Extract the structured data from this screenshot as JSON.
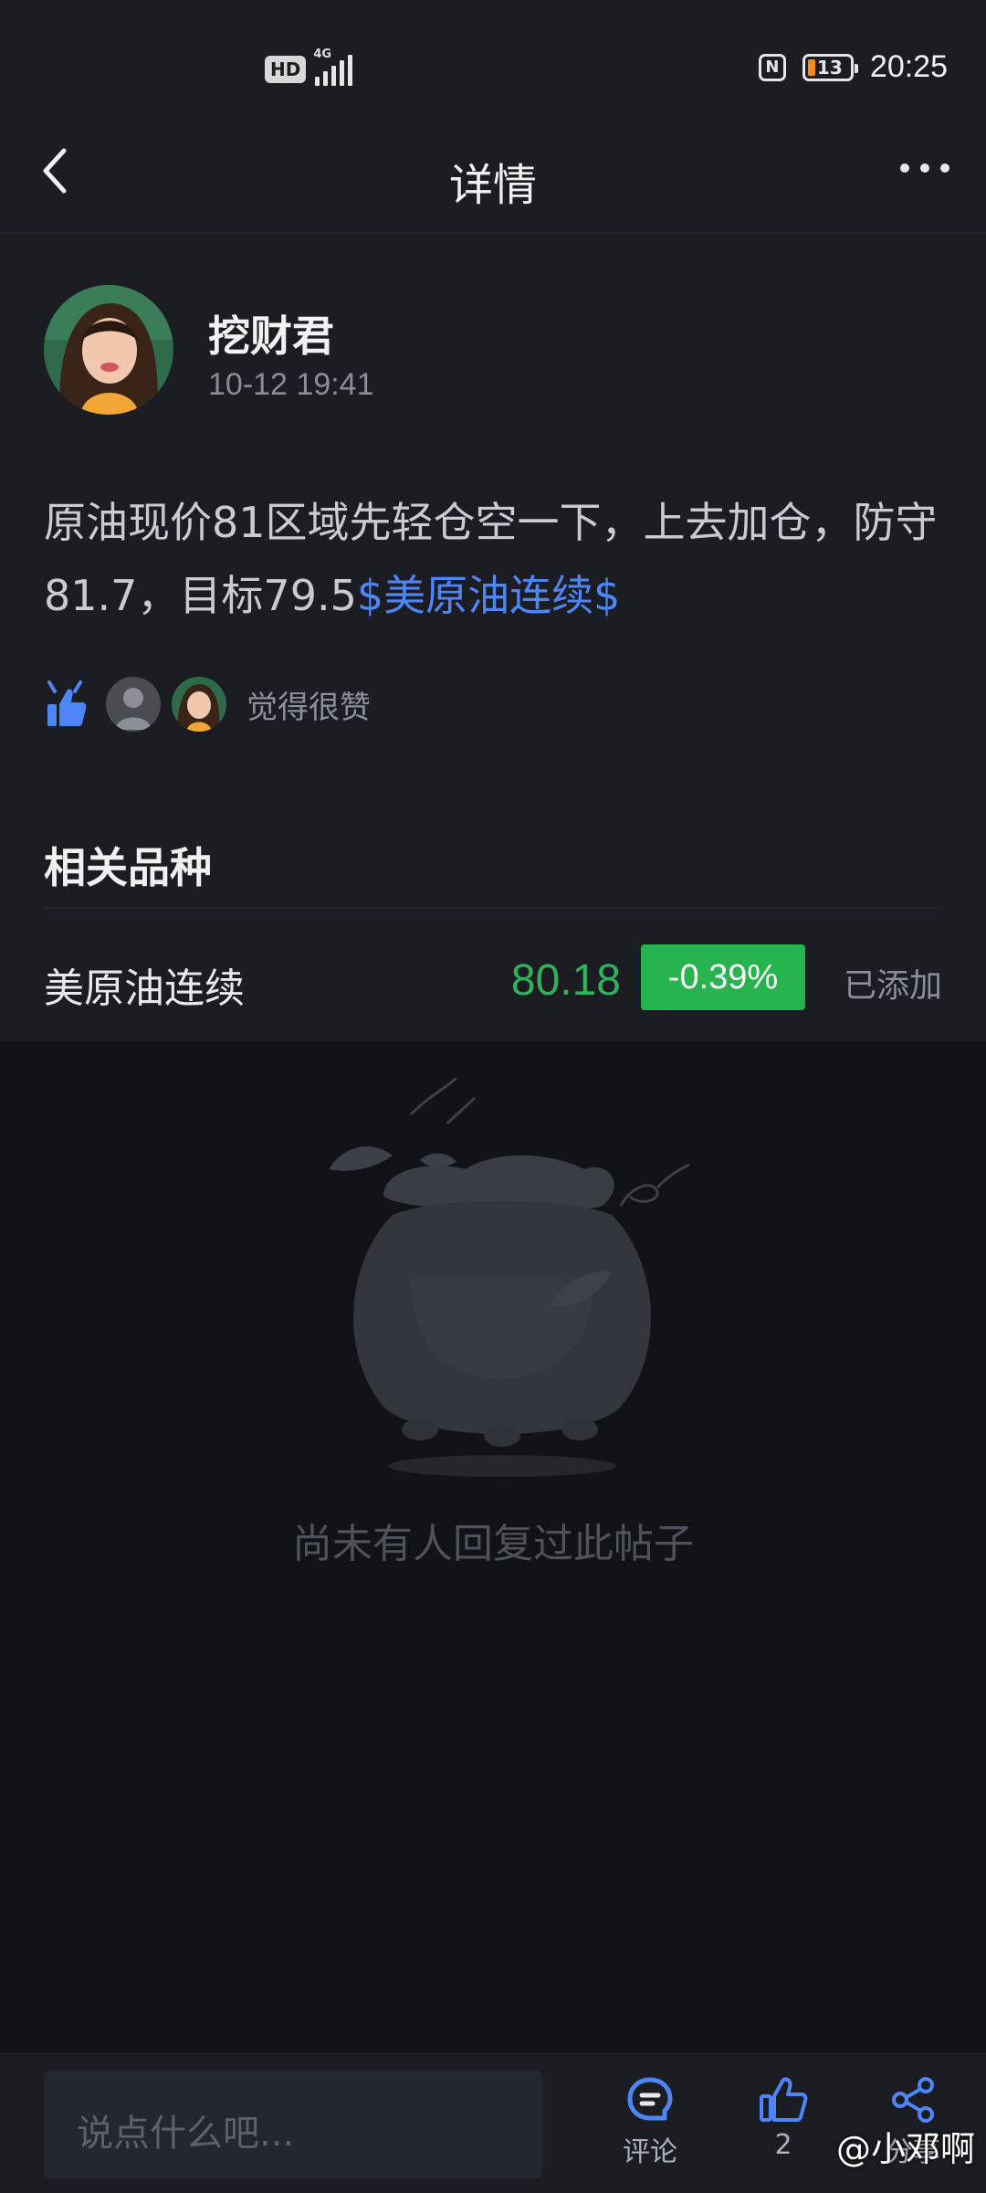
{
  "status_bar": {
    "hd": "HD",
    "network": "4G",
    "nfc": "N",
    "battery": "13",
    "time": "20:25"
  },
  "header": {
    "title": "详情"
  },
  "post": {
    "author": "挖财君",
    "timestamp": "10-12 19:41",
    "text": "原油现价81区域先轻仓空一下，上去加仓，防守81.7，目标79.5",
    "tag": "$美原油连续$",
    "likes_text": "觉得很赞"
  },
  "related": {
    "title": "相关品种",
    "items": [
      {
        "name": "美原油连续",
        "price": "80.18",
        "change": "-0.39%",
        "status": "已添加"
      }
    ]
  },
  "empty_state": {
    "text": "尚未有人回复过此帖子"
  },
  "bottom_bar": {
    "input_placeholder": "说点什么吧...",
    "comment_label": "评论",
    "like_count": "2",
    "share_label": "分享"
  },
  "watermark": "@小邓啊",
  "colors": {
    "background": "#111317",
    "card": "#1b1d23",
    "accent_blue": "#4f86f7",
    "up_green": "#27b34d"
  }
}
